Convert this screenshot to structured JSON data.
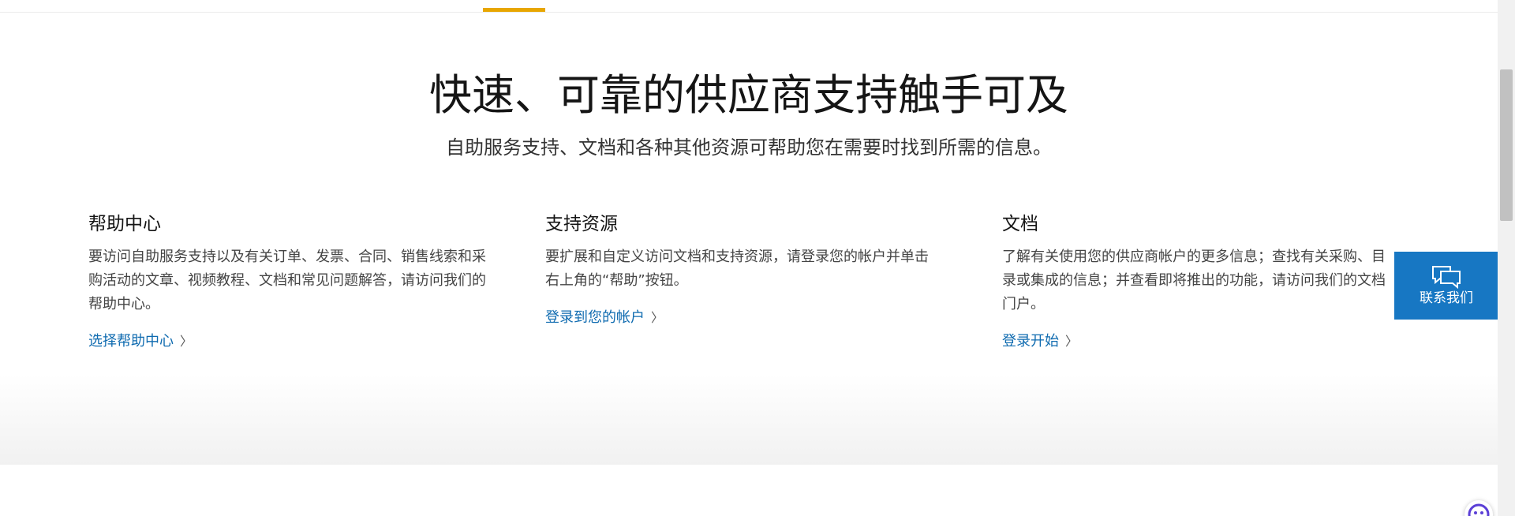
{
  "hero": {
    "title": "快速、可靠的供应商支持触手可及",
    "subtitle": "自助服务支持、文档和各种其他资源可帮助您在需要时找到所需的信息。"
  },
  "columns": [
    {
      "heading": "帮助中心",
      "body": "要访问自助服务支持以及有关订单、发票、合同、销售线索和采购活动的文章、视频教程、文档和常见问题解答，请访问我们的帮助中心。",
      "link": "选择帮助中心"
    },
    {
      "heading": "支持资源",
      "body": "要扩展和自定义访问文档和支持资源，请登录您的帐户并单击右上角的“帮助”按钮。",
      "link": "登录到您的帐户"
    },
    {
      "heading": "文档",
      "body": "了解有关使用您的供应商帐户的更多信息；查找有关采购、目录或集成的信息；并查看即将推出的功能，请访问我们的文档门户。",
      "link": "登录开始"
    }
  ],
  "contact": {
    "label": "联系我们",
    "icon": "chat-bubbles-icon"
  },
  "chevron": "〉",
  "colors": {
    "accent": "#e8a600",
    "link": "#0f6bb0",
    "contact_bg": "#1777c3"
  }
}
